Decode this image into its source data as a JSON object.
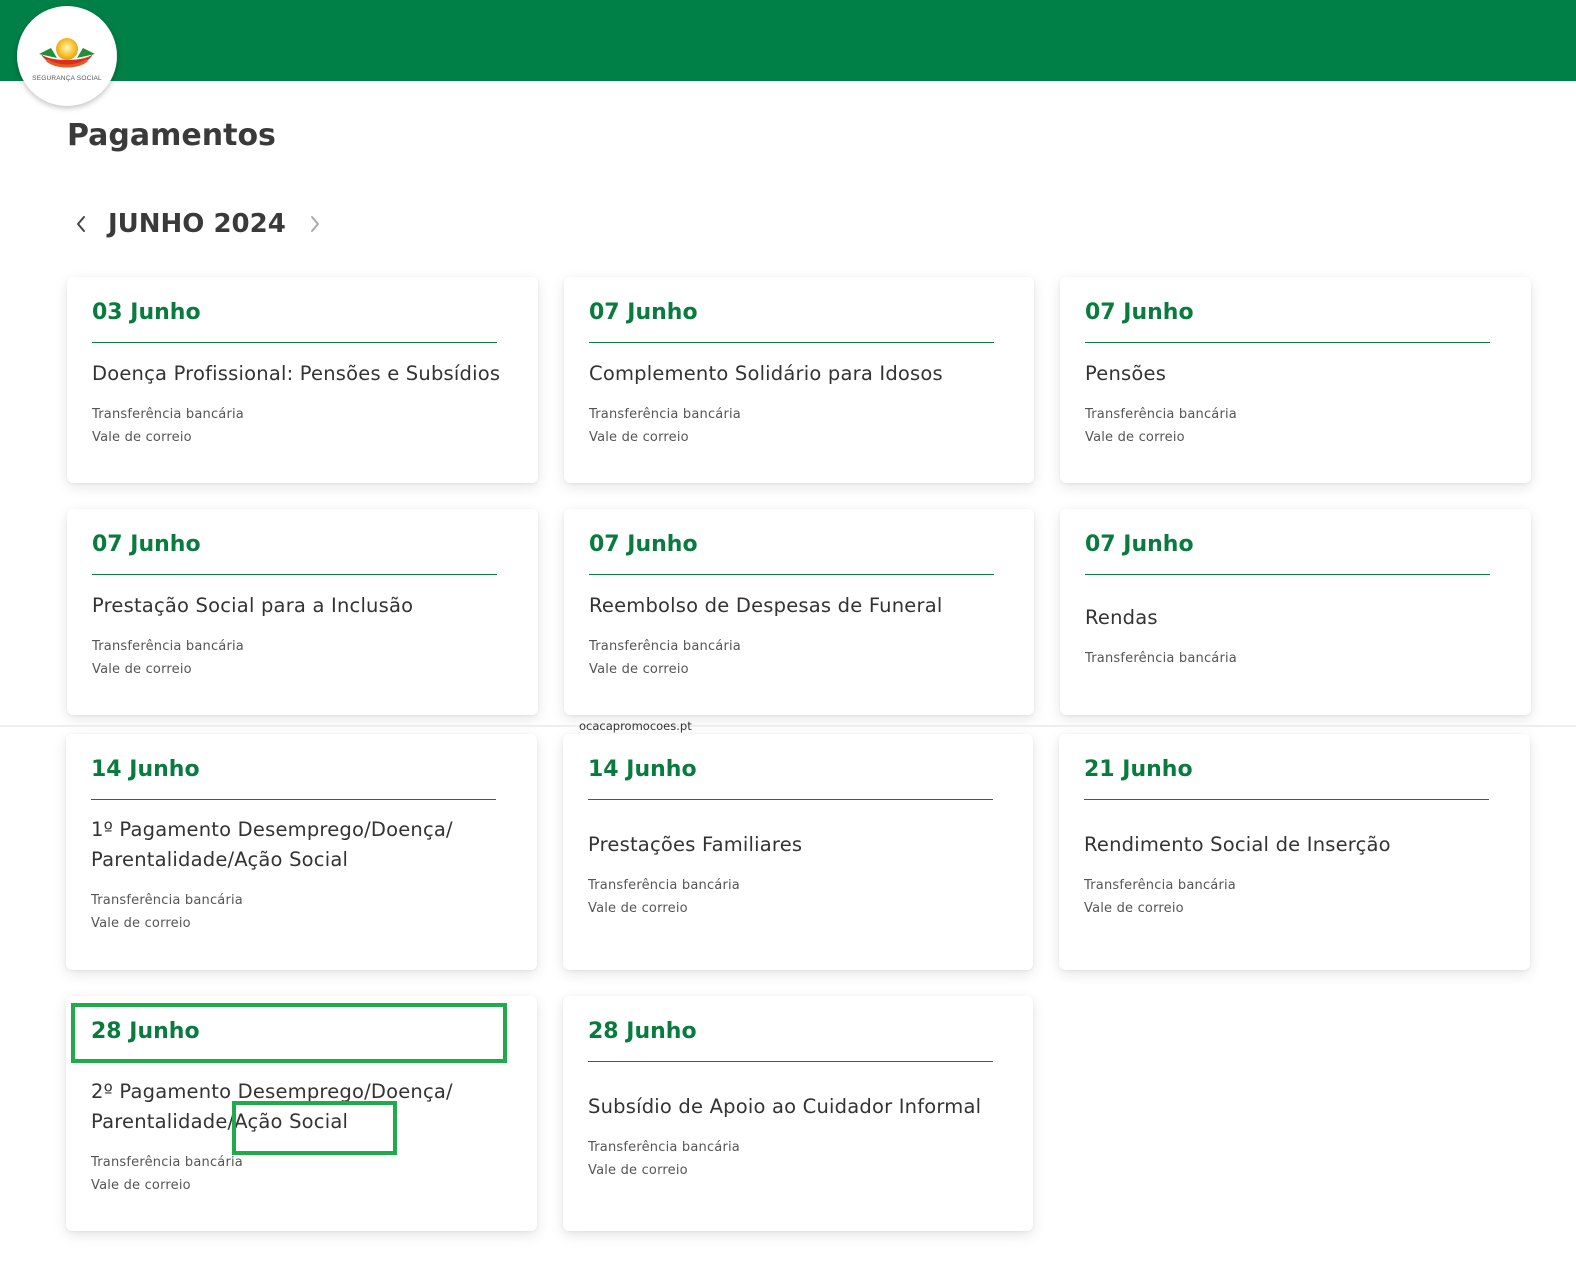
{
  "brand": {
    "logo_text": "SEGURANÇA SOCIAL",
    "header_color": "#008046",
    "accent_color": "#0a7b3e",
    "highlight_color": "#1faa4c"
  },
  "page": {
    "title": "Pagamentos"
  },
  "month_nav": {
    "label": "JUNHO 2024",
    "prev_icon": "chevron-left-icon",
    "next_icon": "chevron-right-icon"
  },
  "watermark": "ocacapromocoes.pt",
  "cards": [
    {
      "date": "03 Junho",
      "title_lines": [
        "Doença Profissional: Pensões e Subsídios"
      ],
      "methods": [
        "Transferência bancária",
        "Vale de correio"
      ]
    },
    {
      "date": "07 Junho",
      "title_lines": [
        "Complemento Solidário para Idosos"
      ],
      "methods": [
        "Transferência bancária",
        "Vale de correio"
      ]
    },
    {
      "date": "07 Junho",
      "title_lines": [
        "Pensões"
      ],
      "methods": [
        "Transferência bancária",
        "Vale de correio"
      ]
    },
    {
      "date": "07 Junho",
      "title_lines": [
        "Prestação Social para a Inclusão"
      ],
      "methods": [
        "Transferência bancária",
        "Vale de correio"
      ]
    },
    {
      "date": "07 Junho",
      "title_lines": [
        "Reembolso de Despesas de Funeral"
      ],
      "methods": [
        "Transferência bancária",
        "Vale de correio"
      ]
    },
    {
      "date": "07 Junho",
      "title_lines": [
        "Rendas"
      ],
      "methods": [
        "Transferência bancária"
      ]
    },
    {
      "date": "14 Junho",
      "title_lines": [
        "1º Pagamento Desemprego/Doença/",
        "Parentalidade/Ação Social"
      ],
      "methods": [
        "Transferência bancária",
        "Vale de correio"
      ]
    },
    {
      "date": "14 Junho",
      "title_lines": [
        "Prestações Familiares"
      ],
      "methods": [
        "Transferência bancária",
        "Vale de correio"
      ]
    },
    {
      "date": "21 Junho",
      "title_lines": [
        "Rendimento Social de Inserção"
      ],
      "methods": [
        "Transferência bancária",
        "Vale de correio"
      ]
    },
    {
      "date": "28 Junho",
      "title_lines": [
        "2º Pagamento Desemprego/Doença/",
        "Parentalidade/Ação Social"
      ],
      "methods": [
        "Transferência bancária",
        "Vale de correio"
      ]
    },
    {
      "date": "28 Junho",
      "title_lines": [
        "Subsídio de Apoio ao Cuidador Informal"
      ],
      "methods": [
        "Transferência bancária",
        "Vale de correio"
      ]
    }
  ]
}
